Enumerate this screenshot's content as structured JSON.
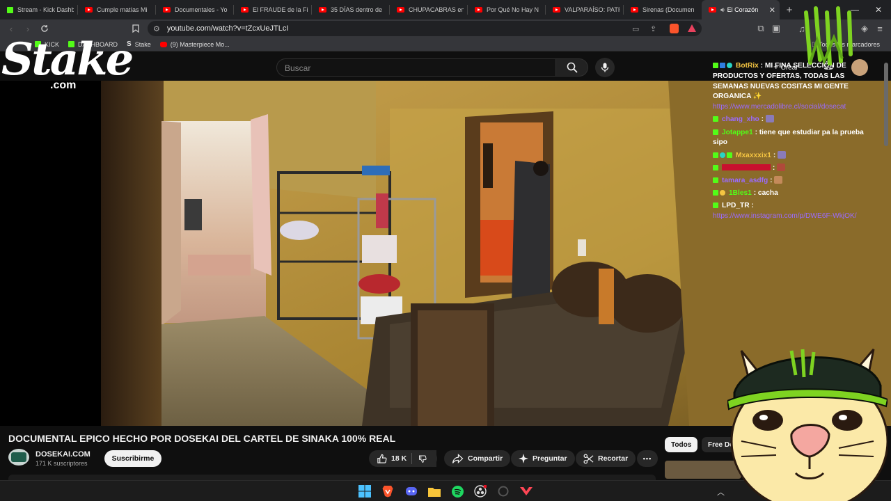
{
  "tabs": [
    {
      "label": "Stream - Kick Dashboard",
      "icon": "kick-icon"
    },
    {
      "label": "Cumple matías Mi",
      "icon": "youtube-icon"
    },
    {
      "label": "Documentales - Yo",
      "icon": "youtube-icon"
    },
    {
      "label": "El FRAUDE de la Fi",
      "icon": "youtube-icon"
    },
    {
      "label": "35 DÍAS dentro de",
      "icon": "youtube-icon"
    },
    {
      "label": "CHUPACABRAS en",
      "icon": "youtube-icon"
    },
    {
      "label": "Por Qué No Hay N",
      "icon": "youtube-icon"
    },
    {
      "label": "VALPARAÍSO: PATR",
      "icon": "youtube-icon"
    },
    {
      "label": "Sirenas (Documen",
      "icon": "youtube-icon"
    },
    {
      "label": "El Corazón",
      "icon": "youtube-icon",
      "active": true
    }
  ],
  "url": "youtube.com/watch?v=tZcxUeJTLcI",
  "bookmarks": [
    {
      "label": "KICK",
      "color": "#53fc18"
    },
    {
      "label": "DASHBOARD",
      "color": "#53fc18"
    },
    {
      "label": "Stake",
      "color": "#ffffff"
    },
    {
      "label": "(9) Masterpiece Mo...",
      "color": "#ff0000"
    }
  ],
  "bookmarks_all": "Todos los marcadores",
  "youtube": {
    "search_placeholder": "Buscar",
    "create_label": "Crear"
  },
  "overlay": {
    "stake_logo": "Stake",
    "stake_com": ".com",
    "chat": [
      {
        "user": "BotRix",
        "user_color": "#f5c542",
        "text": " : MI FINA SELECCIÓN DE PRODUCTOS Y OFERTAS, TODAS LAS SEMANAS NUEVAS COSITAS MI GENTE ORGANICA ✨",
        "link": "https://www.mercadolibre.cl/social/dosecat"
      },
      {
        "user": "chang_xho",
        "user_color": "#9b6bff",
        "text": " :"
      },
      {
        "user": "Jotappe1",
        "user_color": "#53fc18",
        "text": " : tiene que estudiar pa la prueba sipo"
      },
      {
        "user": "Mxaxxxix1",
        "user_color": "#f5c542",
        "text": " :"
      },
      {
        "user": "",
        "user_color": "#c8102e",
        "text": " :"
      },
      {
        "user": "tamara_asdfg",
        "user_color": "#9b6bff",
        "text": " :"
      },
      {
        "user": "1Bles1",
        "user_color": "#53fc18",
        "text": " : cacha"
      },
      {
        "user": "LPD_TR",
        "user_color": "#ffffff",
        "text": " :",
        "link": "https://www.instagram.com/p/DWE6F-WkjOK/"
      }
    ]
  },
  "video_info": {
    "title": "DOCUMENTAL EPICO HECHO POR DOSEKAI DEL CARTEL DE SINAKA 100% REAL",
    "channel": "DOSEKAI.COM",
    "subscribers": "171 K suscriptores",
    "subscribe_label": "Suscribirme",
    "likes": "18 K",
    "share_label": "Compartir",
    "ask_label": "Preguntar",
    "clip_label": "Recortar",
    "more_label": "•••"
  },
  "chips": [
    {
      "label": "Todos",
      "selected": true
    },
    {
      "label": "Free Doc",
      "selected": false
    }
  ],
  "colors": {
    "youtube_red": "#ff0000",
    "kick_green": "#53fc18",
    "chat_link": "#9b6bff",
    "background": "#0f0f0f"
  }
}
